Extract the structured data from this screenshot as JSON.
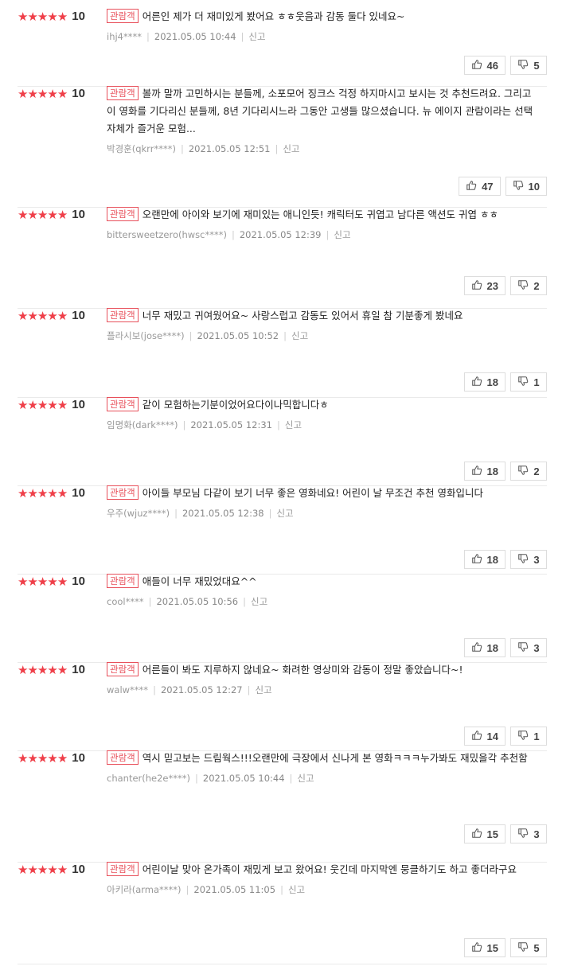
{
  "badge_label": "관람객",
  "report_label": "신고",
  "score_label": "10",
  "reviews": [
    {
      "text": "어른인 제가 더 재미있게 봤어요 ㅎㅎ웃음과 감동 둘다 있네요~",
      "author": "ihj4****",
      "date": "2021.05.05 10:44",
      "likes": "46",
      "dislikes": "5"
    },
    {
      "text": "볼까 말까 고민하시는 분들께, 소포모어 징크스 걱정 하지마시고 보시는 것 추천드려요. 그리고 이 영화를 기다리신 분들께, 8년 기다리시느라 그동안 고생들 많으셨습니다. 뉴 에이지 관람이라는 선택 자체가 즐거운 모험...",
      "author": "박경훈(qkrr****)",
      "date": "2021.05.05 12:51",
      "likes": "47",
      "dislikes": "10"
    },
    {
      "text": "오랜만에 아이와 보기에 재미있는 애니인듯! 캐릭터도 귀엽고 남다른 액션도 귀엽 ㅎㅎ",
      "author": "bittersweetzero(hwsc****)",
      "date": "2021.05.05 12:39",
      "likes": "23",
      "dislikes": "2"
    },
    {
      "text": "너무 재밌고 귀여웠어요~ 사랑스럽고 감동도 있어서 휴일 참 기분좋게 봤네요",
      "author": "플라시보(jose****)",
      "date": "2021.05.05 10:52",
      "likes": "18",
      "dislikes": "1"
    },
    {
      "text": "같이 모험하는기분이었어요다이나믹합니다ㅎ",
      "author": "임명화(dark****)",
      "date": "2021.05.05 12:31",
      "likes": "18",
      "dislikes": "2"
    },
    {
      "text": "아이들 부모님 다같이 보기 너무 좋은 영화네요! 어린이 날 무조건 추천 영화입니다",
      "author": "우주(wjuz****)",
      "date": "2021.05.05 12:38",
      "likes": "18",
      "dislikes": "3"
    },
    {
      "text": "애들이 너무 재밌었대요^^",
      "author": "cool****",
      "date": "2021.05.05 10:56",
      "likes": "18",
      "dislikes": "3"
    },
    {
      "text": "어른들이 봐도 지루하지 않네요~ 화려한 영상미와 감동이 정말 좋았습니다~!",
      "author": "walw****",
      "date": "2021.05.05 12:27",
      "likes": "14",
      "dislikes": "1"
    },
    {
      "text": "역시 믿고보는 드림웍스!!!오랜만에 극장에서 신나게 본 영화ㅋㅋㅋ누가봐도 재밌을각 추천함",
      "author": "chanter(he2e****)",
      "date": "2021.05.05 10:44",
      "likes": "15",
      "dislikes": "3"
    },
    {
      "text": "어린이날 맞아 온가족이 재밌게 보고 왔어요! 웃긴데 마지막엔 뭉클하기도 하고 좋더라구요",
      "author": "아키라(arma****)",
      "date": "2021.05.05 11:05",
      "likes": "15",
      "dislikes": "5"
    }
  ]
}
